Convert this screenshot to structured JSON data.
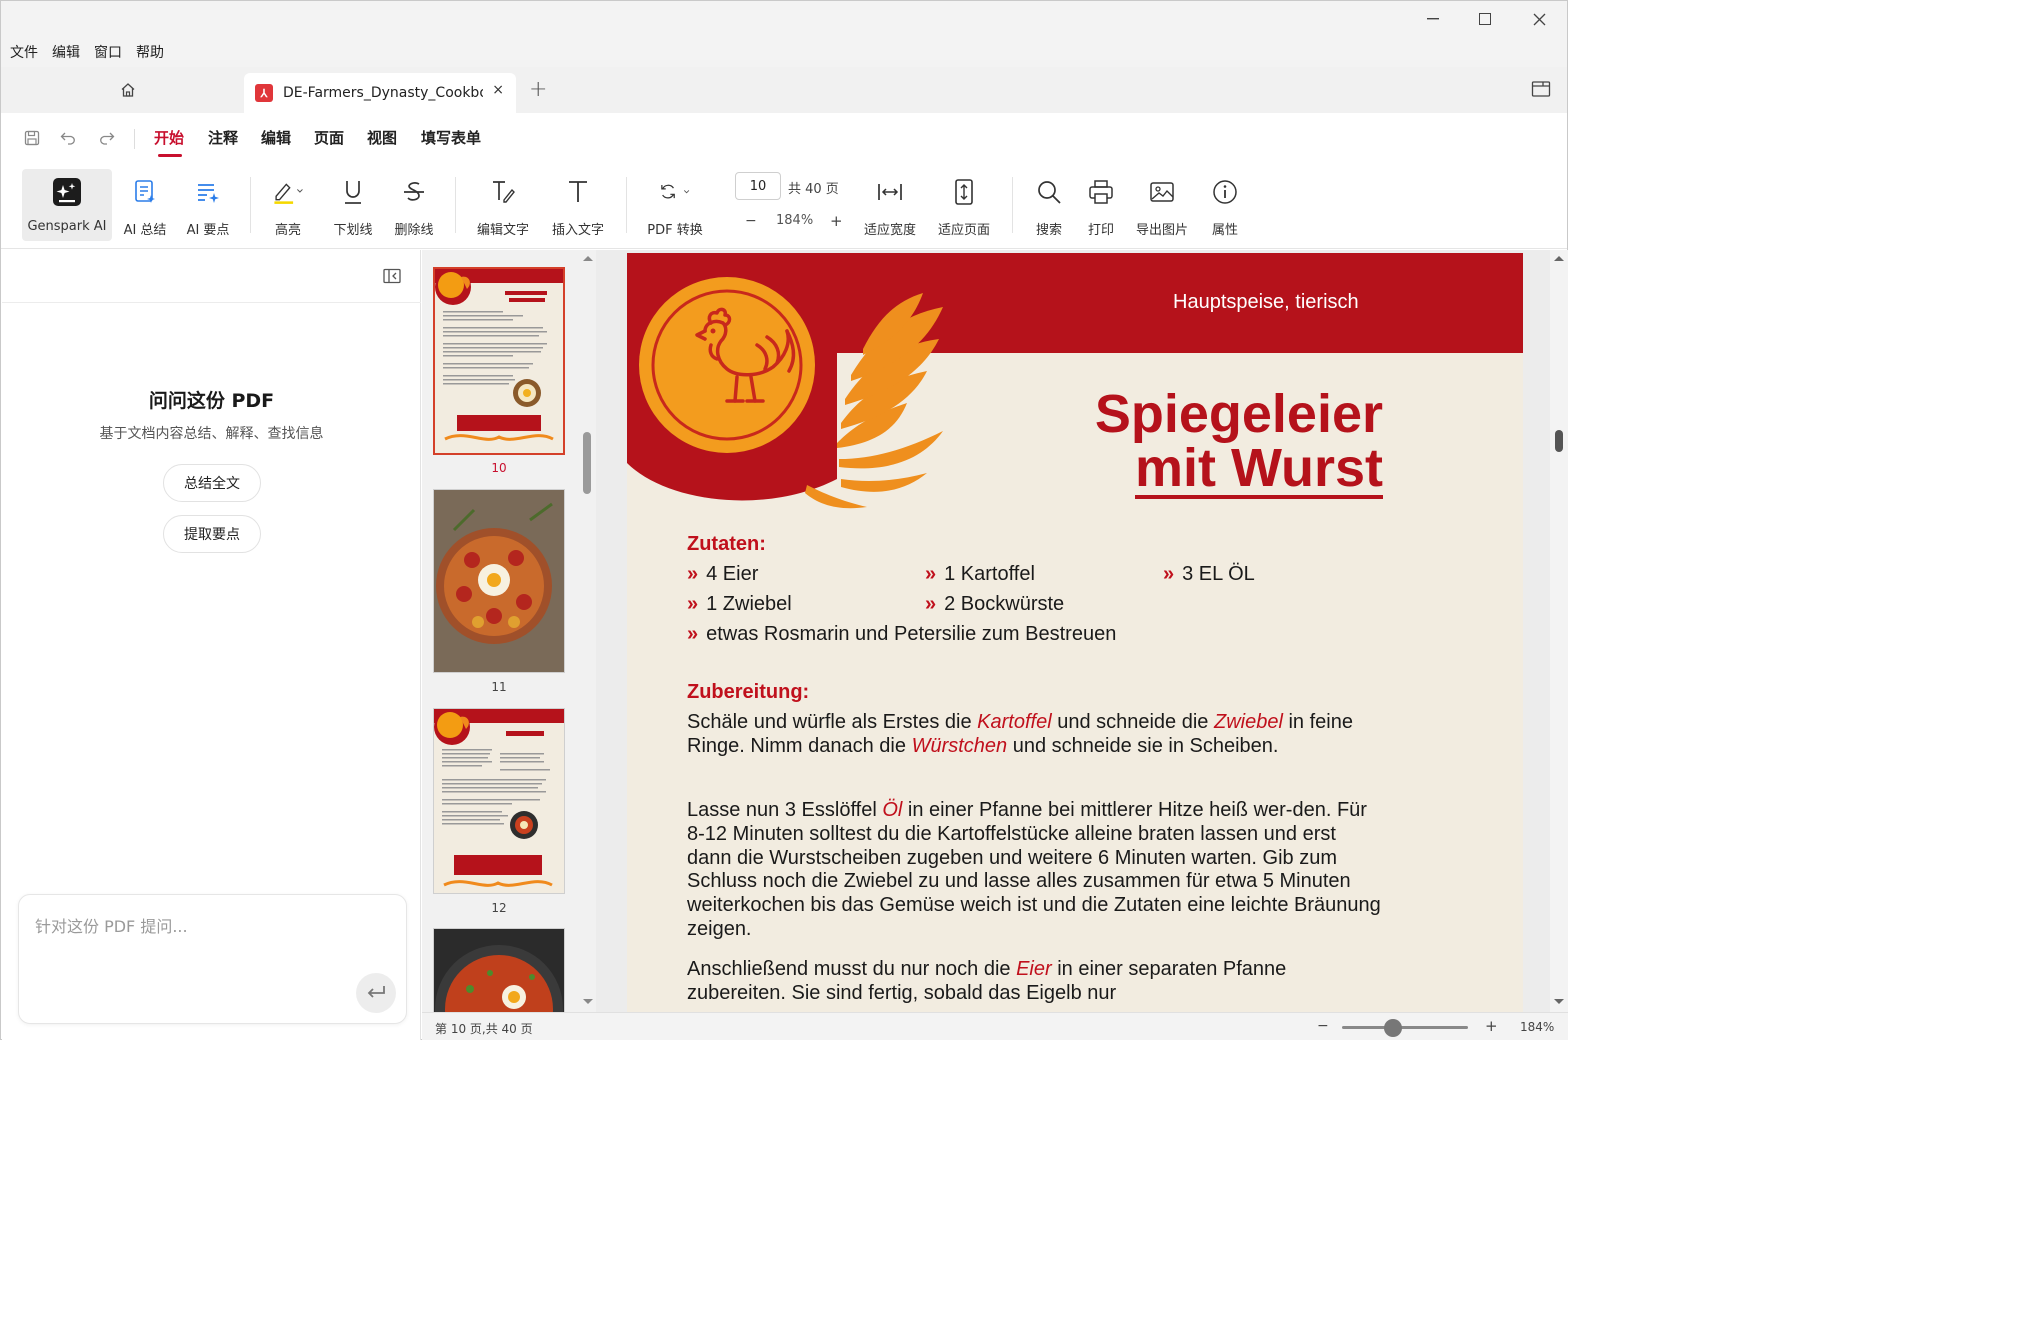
{
  "menu": [
    "文件",
    "编辑",
    "窗口",
    "帮助"
  ],
  "tab": {
    "title": "DE-Farmers_Dynasty_Cookbo...",
    "close": "×",
    "add": "+"
  },
  "ribbon_tabs": [
    "开始",
    "注释",
    "编辑",
    "页面",
    "视图",
    "填写表单"
  ],
  "active_ribbon_tab": "开始",
  "tools": {
    "genspark": "Genspark AI",
    "ai_summary": "AI 总结",
    "ai_points": "AI 要点",
    "highlight": "高亮",
    "underline": "下划线",
    "strikethrough": "删除线",
    "edit_text": "编辑文字",
    "insert_text": "插入文字",
    "pdf_convert": "PDF 转换",
    "fit_width": "适应宽度",
    "fit_page": "适应页面",
    "search": "搜索",
    "print": "打印",
    "export_image": "导出图片",
    "properties": "属性"
  },
  "page_nav": {
    "current": "10",
    "total": "共 40 页",
    "zoom": "184%",
    "minus": "−",
    "plus": "+"
  },
  "ai_panel": {
    "title": "问问这份 PDF",
    "subtitle": "基于文档内容总结、解释、查找信息",
    "btn_summary": "总结全文",
    "btn_points": "提取要点",
    "placeholder": "针对这份 PDF 提问..."
  },
  "thumbnails": [
    {
      "num": "10",
      "title": "Spiegeleier mit Wurst"
    },
    {
      "num": "11"
    },
    {
      "num": "12",
      "title": "Shakshuka"
    }
  ],
  "document": {
    "category": "Hauptspeise, tierisch",
    "title_line1": "Spiegeleier",
    "title_line2": "mit Wurst",
    "ingredients_heading": "Zutaten:",
    "ingredients": [
      "4 Eier",
      "1 Kartoffel",
      "3 EL ÖL",
      "1 Zwiebel",
      "2 Bockwürste",
      "etwas Rosmarin und Petersilie zum Bestreuen"
    ],
    "prep_heading": "Zubereitung:",
    "p1": [
      "Schäle und würfle als Erstes die ",
      "Kartoffel",
      " und schneide die ",
      "Zwiebel",
      " in feine Ringe. Nimm danach die ",
      "Würstchen",
      " und schneide sie in Scheiben."
    ],
    "p2": [
      "Lasse nun 3 Esslöffel ",
      "Öl",
      " in einer Pfanne bei mittlerer Hitze heiß wer-den. Für 8-12 Minuten solltest du die Kartoffelstücke alleine braten lassen und erst dann die Wurstscheiben zugeben und weitere 6 Minuten warten. Gib zum Schluss noch die Zwiebel zu und lasse alles zusammen für etwa 5 Minuten weiterkochen bis das Gemüse weich ist und die Zutaten eine leichte Bräunung zeigen."
    ],
    "p3": [
      "Anschließend musst du nur noch die ",
      "Eier",
      " in einer separaten Pfanne zubereiten. Sie sind fertig, sobald das Eigelb nur"
    ]
  },
  "status": {
    "page": "第 10 页,共 40 页",
    "zoom": "184%",
    "minus": "−",
    "plus": "+"
  },
  "colors": {
    "accent": "#c8102e",
    "recipe_red": "#b5121b",
    "orange": "#f39c12",
    "paper": "#f2ece0"
  }
}
